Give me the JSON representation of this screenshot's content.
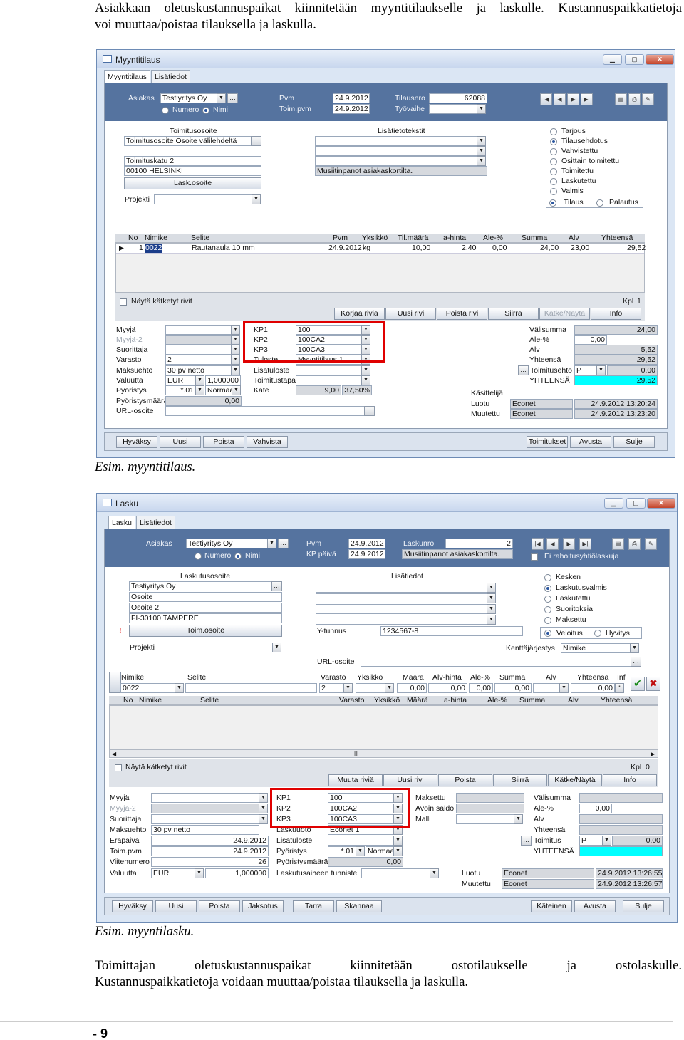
{
  "doc": {
    "para1_l1": "Asiakkaan oletuskustannuspaikat kiinnitetään myyntitilaukselle ja laskulle. Kustannuspaikkatietoja",
    "para1_l2": "voi muuttaa/poistaa tilauksella ja laskulla.",
    "caption1": "Esim. myyntitilaus.",
    "caption2": "Esim. myyntilasku.",
    "para2_l1": "Toimittajan oletuskustannuspaikat kiinnitetään ostotilaukselle ja ostolaskulle.",
    "para2_l2": "Kustannuspaikkatietoja voidaan muuttaa/poistaa tilauksella ja laskulla.",
    "page_number": "- 9"
  },
  "order": {
    "title": "Myyntitilaus",
    "tabs": [
      "Myyntitilaus",
      "Lisätiedot"
    ],
    "asiakas_label": "Asiakas",
    "asiakas": "Testiyritys Oy",
    "numero": "Numero",
    "nimi": "Nimi",
    "pvm_label": "Pvm",
    "pvm": "24.9.2012",
    "toimpvm_label": "Toim.pvm",
    "toimpvm": "24.9.2012",
    "tilausnro_label": "Tilausnro",
    "tilausnro": "62088",
    "tyovaihe_label": "Työvaihe",
    "toimitusosoite_label": "Toimitusosoite",
    "toimitusosoite_1": "Toimitusosoite Osoite välilehdeltä",
    "toimitusosoite_2": "Toimituskatu 2",
    "toimitusosoite_3": "00100 HELSINKI",
    "lask_osoite": "Lask.osoite",
    "projekti": "Projekti",
    "lisatietotekstit": "Lisätietotekstit",
    "musiitinpanot": "Musiitinpanot asiakaskortilta.",
    "status": [
      "Tarjous",
      "Tilausehdotus",
      "Vahvistettu",
      "Osittain toimitettu",
      "Toimitettu",
      "Laskutettu",
      "Valmis"
    ],
    "tilaus": "Tilaus",
    "palautus": "Palautus",
    "grid_headers": [
      "No",
      "Nimike",
      "Selite",
      "Pvm",
      "Yksikkö",
      "Til.määrä",
      "a-hinta",
      "Ale-%",
      "Summa",
      "Alv",
      "Yhteensä"
    ],
    "row": [
      "1",
      "0022",
      "Rautanaula 10 mm",
      "24.9.2012",
      "kg",
      "10,00",
      "2,40",
      "0,00",
      "24,00",
      "23,00",
      "29,52"
    ],
    "nayta": "Näytä kätketyt rivit",
    "kpl": "Kpl",
    "kpl_val": "1",
    "row_buttons": [
      "Korjaa riviä",
      "Uusi rivi",
      "Poista rivi",
      "Siirrä",
      "Kätke/Näytä",
      "Info"
    ],
    "left_labels": [
      "Myyjä",
      "Myyjä-2",
      "Suorittaja",
      "Varasto",
      "Maksuehto",
      "Valuutta",
      "Pyöristys",
      "Pyöristysmäärä",
      "URL-osoite"
    ],
    "varasto": "2",
    "maksuehto": "30 pv netto",
    "valuutta": "EUR",
    "kurssi": "1,000000",
    "pyoristys": "*.01",
    "pyor_tapa": "Normaa",
    "pyor_maara": "0,00",
    "kp_labels": [
      "KP1",
      "KP2",
      "KP3"
    ],
    "kp_values": [
      "100",
      "100CA2",
      "100CA3"
    ],
    "tuloste": "Tuloste",
    "tuloste_val": "Myyntitilaus 1",
    "lisatuloste": "Lisätuloste",
    "toimitustapa": "Toimitustapa",
    "kate": "Kate",
    "kate_val": "9,00",
    "kate_pct": "37,50%",
    "sum_labels": [
      "Välisumma",
      "Ale-%",
      "Alv",
      "Yhteensä",
      "Toimitusehto",
      "YHTEENSÄ"
    ],
    "valisumma": "24,00",
    "ale": "0,00",
    "alv": "5,52",
    "yhteensa": "29,52",
    "toimitusehto": "P",
    "toimitusehto_val": "0,00",
    "yhteensa_total": "29,52",
    "kasittelija": "Käsittelijä",
    "luotu": "Luotu",
    "muutettu": "Muutettu",
    "econet": "Econet",
    "luotu_time": "24.9.2012 13:20:24",
    "muutettu_time": "24.9.2012 13:23:20",
    "bottom_left": [
      "Hyväksy",
      "Uusi",
      "Poista",
      "Vahvista"
    ],
    "bottom_right": [
      "Toimitukset",
      "Avusta",
      "Sulje"
    ]
  },
  "invoice": {
    "title": "Lasku",
    "tabs": [
      "Lasku",
      "Lisätiedot"
    ],
    "asiakas_label": "Asiakas",
    "asiakas": "Testiyritys Oy",
    "numero": "Numero",
    "nimi": "Nimi",
    "pvm_label": "Pvm",
    "pvm": "24.9.2012",
    "kppaiva_label": "KP päivä",
    "kppaiva": "24.9.2012",
    "laskunro_label": "Laskunro",
    "laskunro": "2",
    "musiitinpanot": "Musiitinpanot asiakaskortilta.",
    "rahoitus": "Ei rahoitusyhtiölaskuja",
    "laskutusosoite": "Laskutusosoite",
    "addr": [
      "Testiyritys Oy",
      "Osoite",
      "Osoite 2",
      "FI-30100  TAMPERE"
    ],
    "toim_osoite": "Toim.osoite",
    "projekti": "Projekti",
    "lisatiedot": "Lisätiedot",
    "ytunnus_label": "Y-tunnus",
    "ytunnus": "1234567-8",
    "url": "URL-osoite",
    "status": [
      "Kesken",
      "Laskutusvalmis",
      "Laskutettu",
      "Suoritoksia",
      "Maksettu"
    ],
    "veloitus": "Veloitus",
    "hyvitys": "Hyvitys",
    "kentta_label": "Kenttäjärjestys",
    "kentta": "Nimike",
    "edit_headers": [
      "Nimike",
      "Selite",
      "Varasto",
      "Yksikkö",
      "Määrä",
      "Alv-hinta",
      "Ale-%",
      "Summa",
      "Alv",
      "Yhteensä",
      "Inf"
    ],
    "edit_row": [
      "0022",
      "",
      "2",
      "",
      "0,00",
      "0,00",
      "0,00",
      "0,00",
      "",
      "0,00"
    ],
    "grid_headers": [
      "No",
      "Nimike",
      "Selite",
      "Varasto",
      "Yksikkö",
      "Määrä",
      "a-hinta",
      "Ale-%",
      "Summa",
      "Alv",
      "Yhteensä"
    ],
    "nayta": "Näytä kätketyt rivit",
    "kpl": "Kpl",
    "kpl_val": "0",
    "row_buttons": [
      "Muuta riviä",
      "Uusi rivi",
      "Poista",
      "Siirrä",
      "Kätke/Näytä",
      "Info"
    ],
    "left_labels": [
      "Myyjä",
      "Myyjä-2",
      "Suorittaja",
      "Maksuehto",
      "Eräpäivä",
      "Toim.pvm",
      "Viitenumero",
      "Valuutta"
    ],
    "maksuehto": "30 pv netto",
    "erapaiva": "24.9.2012",
    "toimpvm": "24.9.2012",
    "viitenumero": "26",
    "valuutta": "EUR",
    "kurssi": "1,000000",
    "kp_labels": [
      "KP1",
      "KP2",
      "KP3"
    ],
    "kp_values": [
      "100",
      "100CA2",
      "100CA3"
    ],
    "laskuohjelma": "Laskuuoto",
    "laskuohjelma_val": "Econet 1",
    "lisatuloste": "Lisätuloste",
    "pyoristys": "Pyöristys",
    "pyor": "*.01",
    "pyor_tapa": "Normaa",
    "pyoristysmaara": "Pyöristysmäärä",
    "pyor_maara": "0,00",
    "laskutusaihe": "Laskutusaiheen tunniste",
    "mid_labels": [
      "Maksettu",
      "Avoin saldo",
      "Malli"
    ],
    "sum_labels": [
      "Välisumma",
      "Ale-%",
      "Alv",
      "Yhteensä",
      "Toimitus",
      "YHTEENSÄ"
    ],
    "ale": "0,00",
    "toimitus": "P",
    "toimitus_val": "0,00",
    "luotu": "Luotu",
    "muutettu": "Muutettu",
    "econet": "Econet",
    "luotu_time": "24.9.2012 13:26:55",
    "muutettu_time": "24.9.2012 13:26:57",
    "bottom_left": [
      "Hyväksy",
      "Uusi",
      "Poista",
      "Jaksotus",
      "Tarra",
      "Skannaa"
    ],
    "bottom_right": [
      "Käteinen",
      "Avusta",
      "Sulje"
    ]
  }
}
